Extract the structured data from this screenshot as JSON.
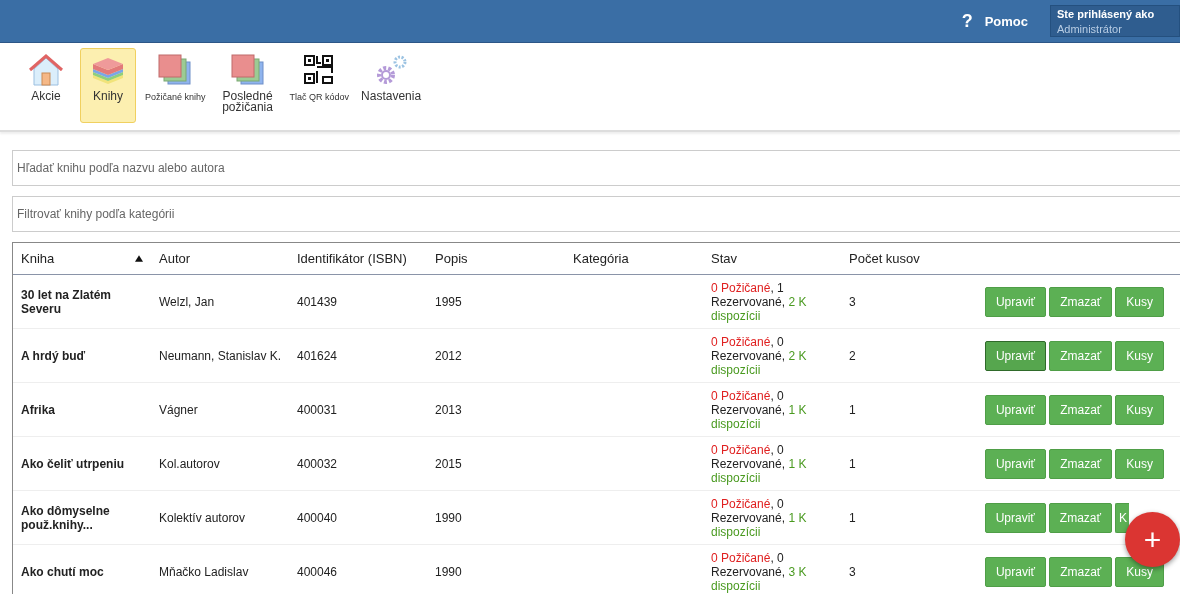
{
  "header": {
    "help": "Pomoc",
    "help_icon": "?",
    "user_label": "Ste prihlásený ako",
    "user_name": "Administrátor"
  },
  "toolbar": [
    {
      "label": "Akcie",
      "selected": false
    },
    {
      "label": "Knihy",
      "selected": true
    },
    {
      "label": "Požičané knihy",
      "selected": false
    },
    {
      "label": "Posledné požičania",
      "selected": false
    },
    {
      "label": "Tlač QR kódov",
      "selected": false
    },
    {
      "label": "Nastavenia",
      "selected": false
    }
  ],
  "search": {
    "placeholder": "Hľadať knihu podľa nazvu alebo autora"
  },
  "filter": {
    "placeholder": "Filtrovať knihy podľa kategórii"
  },
  "table": {
    "columns": [
      {
        "label": "Kniha",
        "sorted": true
      },
      {
        "label": "Autor",
        "sorted": false
      },
      {
        "label": "Identifikátor (ISBN)",
        "sorted": false
      },
      {
        "label": "Popis",
        "sorted": false
      },
      {
        "label": "Kategória",
        "sorted": false
      },
      {
        "label": "Stav",
        "sorted": false
      },
      {
        "label": "Počet kusov",
        "sorted": false
      }
    ],
    "rows": [
      {
        "title": "30 let na Zlatém Severu",
        "author": "Welzl, Jan",
        "isbn": "401439",
        "description": "1995",
        "borrowed": "0 Požičané",
        "reserved": ", 1 Rezervované,",
        "available": "2 K dispozícii",
        "count": "3",
        "buttons": [
          {
            "label": "Upraviť",
            "focused": false
          },
          {
            "label": "Zmazať",
            "focused": false
          },
          {
            "label": "Kusy",
            "focused": false
          }
        ]
      },
      {
        "title": "A hrdý buď",
        "author": "Neumann, Stanislav K.",
        "isbn": "401624",
        "description": "2012",
        "borrowed": "0 Požičané",
        "reserved": ", 0 Rezervované,",
        "available": "2 K dispozícii",
        "count": "2",
        "buttons": [
          {
            "label": "Upraviť",
            "focused": true
          },
          {
            "label": "Zmazať",
            "focused": false
          },
          {
            "label": "Kusy",
            "focused": false
          }
        ]
      },
      {
        "title": "Afrika",
        "author": "Vágner",
        "isbn": "400031",
        "description": "2013",
        "borrowed": "0 Požičané",
        "reserved": ", 0 Rezervované,",
        "available": "1 K dispozícii",
        "count": "1",
        "buttons": [
          {
            "label": "Upraviť",
            "focused": false
          },
          {
            "label": "Zmazať",
            "focused": false
          },
          {
            "label": "Kusy",
            "focused": false
          }
        ]
      },
      {
        "title": "Ako čeliť utrpeniu",
        "author": "Kol.autorov",
        "isbn": "400032",
        "description": "2015",
        "borrowed": "0 Požičané",
        "reserved": ", 0 Rezervované,",
        "available": "1 K dispozícii",
        "count": "1",
        "buttons": [
          {
            "label": "Upraviť",
            "focused": false
          },
          {
            "label": "Zmazať",
            "focused": false
          },
          {
            "label": "Kusy",
            "focused": false
          }
        ]
      },
      {
        "title": "Ako dômyselne použ.knihy...",
        "author": "Kolektív autorov",
        "isbn": "400040",
        "description": "1990",
        "borrowed": "0 Požičané",
        "reserved": ", 0 Rezervované,",
        "available": "1 K dispozícii",
        "count": "1",
        "buttons": [
          {
            "label": "Upraviť",
            "focused": false
          },
          {
            "label": "Zmazať",
            "focused": false
          },
          {
            "label": "K",
            "focused": false
          }
        ]
      },
      {
        "title": "Ako chutí moc",
        "author": "Mňačko Ladislav",
        "isbn": "400046",
        "description": "1990",
        "borrowed": "0 Požičané",
        "reserved": ", 0 Rezervované,",
        "available": "3 K dispozícii",
        "count": "3",
        "buttons": [
          {
            "label": "Upraviť",
            "focused": false
          },
          {
            "label": "Zmazať",
            "focused": false
          },
          {
            "label": "Kusy",
            "focused": false
          }
        ]
      }
    ]
  },
  "fab": {
    "label": "+"
  }
}
